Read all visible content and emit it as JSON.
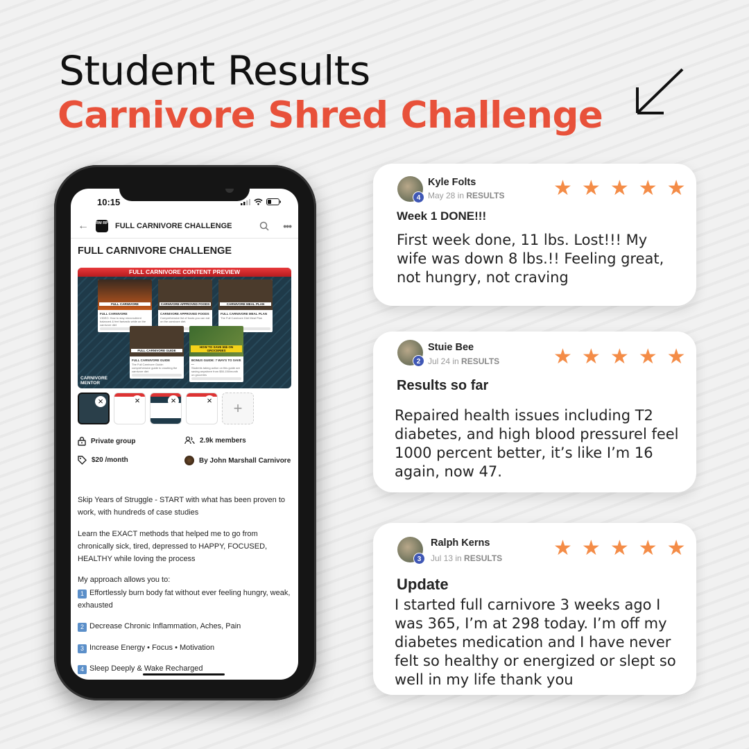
{
  "headline": {
    "line1": "Student Results",
    "line2": "Carnivore Shred Challenge"
  },
  "colors": {
    "accent": "#e8513a",
    "star": "#f48c47",
    "level_badge": "#3f57b5"
  },
  "phone": {
    "time": "10:15",
    "appbar": {
      "logo": "RM RP",
      "title": "FULL CARNIVORE CHALLENGE"
    },
    "page_title": "FULL CARNIVORE CHALLENGE",
    "preview": {
      "banner": "FULL CARNIVORE CONTENT PREVIEW",
      "cards": [
        {
          "image_label": "FULL CARNIVORE",
          "tag": "VIDEO",
          "title": "FULL CARNIVORE",
          "desc": "VIDEO: How to stay micronutrient balanced & feel fantastic while on the carnivore diet",
          "progress": "0%"
        },
        {
          "image_label": "CARNIVORE APPROVED FOODS",
          "tag": "RESOURCE FILE:",
          "title": "CARNIVORE APPROVED FOODS",
          "desc": "Comprehensive list of foods you can eat on the carnivore diet.",
          "progress": "0%"
        },
        {
          "image_label": "CARNIVORE MEAL PLAN",
          "tag": "RESOURCE FILE:",
          "title": "FULL CARNIVORE MEAL PLAN",
          "desc": "The Full Carnivore Diet Meal Plan",
          "progress": "0%"
        },
        {
          "image_label": "FULL CARNIVORE GUIDE",
          "tag": "RESOURCE FILE:",
          "title": "FULL CARNIVORE GUIDE",
          "desc": "The Full Carnivore Guide: comprehensive guide to crushing the carnivore diet",
          "progress": "0%"
        },
        {
          "image_label": "HOW TO SAVE $$$ ON GROCERIES",
          "tag": "",
          "title": "BONUS GUIDE: 7 WAYS TO SAVE ...",
          "desc": "Students taking action on this guide are saving anywhere from $50-150/month on groceries",
          "progress": "0%"
        }
      ],
      "brand": "CARNIVORE MENTOR"
    },
    "meta": {
      "privacy": "Private group",
      "members": "2.9k members",
      "price": "$20 /month",
      "owner": "By John Marshall Carnivore"
    },
    "description": {
      "p1": "Skip Years of Struggle - START with what has been proven to work, with hundreds of case studies",
      "p2": "Learn the EXACT methods that helped me to go from chronically sick, tired, depressed to HAPPY, FOCUSED, HEALTHY while loving the process",
      "intro": "My approach allows you to:",
      "items": [
        {
          "n": "1",
          "text": "Effortlessly burn body fat without ever feeling hungry, weak, exhausted"
        },
        {
          "n": "2",
          "text": "Decrease Chronic Inflammation, Aches, Pain"
        },
        {
          "n": "3",
          "text": "Increase Energy • Focus • Motivation"
        },
        {
          "n": "4",
          "text": "Sleep Deeply & Wake Recharged"
        }
      ]
    }
  },
  "reviews": [
    {
      "name": "Kyle Folts",
      "level": "4",
      "date": "May 28 in",
      "category": "RESULTS",
      "rating": 5,
      "title": "Week 1 DONE!!!",
      "body": "First week done, 11 lbs. Lost!!! My wife was down 8 lbs.!! Feeling great, not hungry, not craving"
    },
    {
      "name": "Stuie Bee",
      "level": "2",
      "date": "Jul 24 in",
      "category": "RESULTS",
      "rating": 5,
      "title": "Results so far",
      "body": "Repaired health issues including T2 diabetes, and high blood pressurel feel 1000 percent better, it’s like I’m 16 again, now 47."
    },
    {
      "name": "Ralph Kerns",
      "level": "3",
      "date": "Jul 13 in",
      "category": "RESULTS",
      "rating": 5,
      "title": "Update",
      "body": "I started full carnivore 3 weeks ago I was 365, I’m at 298 today. I’m off my diabetes medication and I have never felt so healthy or energized or slept so well in my life thank you"
    }
  ]
}
